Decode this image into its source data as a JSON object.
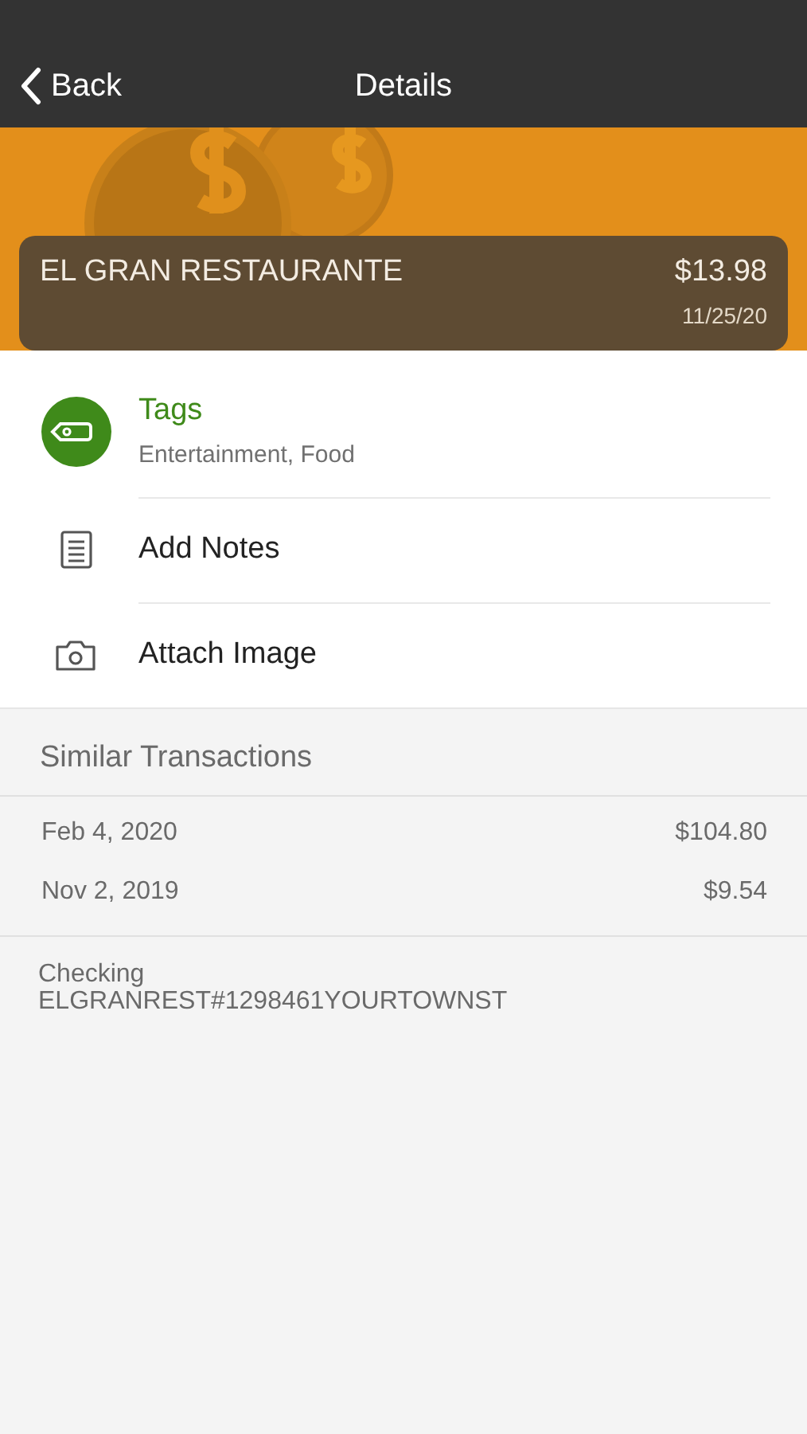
{
  "nav": {
    "back": "Back",
    "title": "Details"
  },
  "transaction": {
    "merchant": "EL GRAN RESTAURANTE",
    "amount": "$13.98",
    "date": "11/25/20"
  },
  "actions": [
    {
      "kind": "tags",
      "label": "Tags",
      "detail": "Entertainment, Food"
    },
    {
      "kind": "notes",
      "label": "Add Notes"
    },
    {
      "kind": "image",
      "label": "Attach Image"
    }
  ],
  "similar": {
    "title": "Similar Transactions",
    "rows": [
      {
        "date": "Feb 4, 2020",
        "amount": "$104.80"
      },
      {
        "date": "Nov 2, 2019",
        "amount": "$9.54"
      }
    ]
  },
  "account": {
    "name": "Checking",
    "description": "ELGRANREST#1298461YOURTOWNST"
  }
}
